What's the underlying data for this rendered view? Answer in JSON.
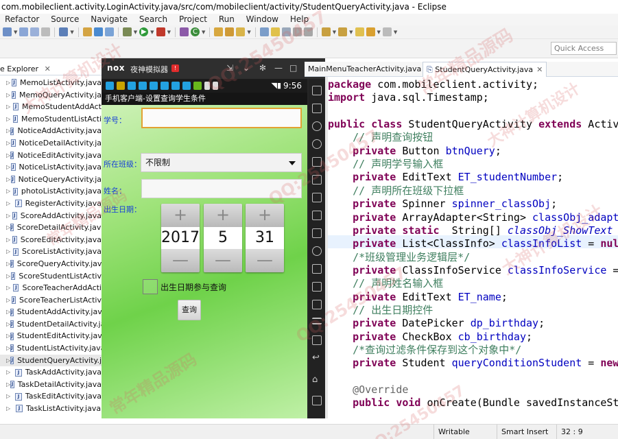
{
  "window": {
    "title": "com.mobileclient.activity.LoginActivity.java/src/com/mobileclient/activity/StudentQueryActivity.java - Eclipse"
  },
  "menu": [
    "Refactor",
    "Source",
    "Navigate",
    "Search",
    "Project",
    "Run",
    "Window",
    "Help"
  ],
  "quick_access": {
    "placeholder": "Quick Access"
  },
  "package_explorer": {
    "title": "e Explorer",
    "close": "✕",
    "files": [
      "MemoListActivity.java",
      "MemoQueryActivity.ja",
      "MemoStudentAddAct",
      "MemoStudentListActi",
      "NoticeAddActivity.java",
      "NoticeDetailActivity.ja",
      "NoticeEditActivity.java",
      "NoticeListActivity.java",
      "NoticeQueryActivity.ja",
      "photoListActivity.java",
      "RegisterActivity.java",
      "ScoreAddActivity.java",
      "ScoreDetailActivity.java",
      "ScoreEditActivity.java",
      "ScoreListActivity.java",
      "ScoreQueryActivity.jav",
      "ScoreStudentListActiv",
      "ScoreTeacherAddActi",
      "ScoreTeacherListActiv",
      "StudentAddActivity.jav",
      "StudentDetailActivity.ja",
      "StudentEditActivity.java",
      "StudentListActivity.java",
      "StudentQueryActivity.j",
      "TaskAddActivity.java",
      "TaskDetailActivity.java",
      "TaskEditActivity.java",
      "TaskListActivity.java"
    ],
    "selected_index": 23
  },
  "emulator": {
    "brand": "nox",
    "name": "夜神模拟器",
    "time": "9:56",
    "app_title": "手机客户端-设置查询学生条件",
    "labels": {
      "student_number": "学号：",
      "class": "所在班级：",
      "name": "姓名：",
      "birthday": "出生日期："
    },
    "spinner_value": "不限制",
    "date": {
      "year": "2017",
      "month": "5",
      "day": "31"
    },
    "plus": "+",
    "minus": "—",
    "checkbox_label": "出生日期参与查询",
    "query_button": "查询"
  },
  "editor": {
    "tabs": [
      "MainMenuTeacherActivity.java",
      "StudentQueryActivity.java"
    ],
    "active_tab": 1,
    "lines": [
      [
        [
          "kw",
          "package"
        ],
        [
          "t",
          " com.mobileclient.activity;"
        ]
      ],
      [
        [
          "kw",
          "import"
        ],
        [
          "t",
          " java.sql.Timestamp;"
        ]
      ],
      [],
      [
        [
          "kw",
          "public"
        ],
        [
          "t",
          " "
        ],
        [
          "kw",
          "class"
        ],
        [
          "t",
          " StudentQueryActivity "
        ],
        [
          "kw",
          "extends"
        ],
        [
          "t",
          " Activi"
        ]
      ],
      [
        [
          "t",
          "    "
        ],
        [
          "cm",
          "// 声明查询按钮"
        ]
      ],
      [
        [
          "t",
          "    "
        ],
        [
          "kw",
          "private"
        ],
        [
          "t",
          " Button "
        ],
        [
          "fd",
          "btnQuery"
        ],
        [
          "t",
          ";"
        ]
      ],
      [
        [
          "t",
          "    "
        ],
        [
          "cm",
          "// 声明学号输入框"
        ]
      ],
      [
        [
          "t",
          "    "
        ],
        [
          "kw",
          "private"
        ],
        [
          "t",
          " EditText "
        ],
        [
          "fd",
          "ET_studentNumber"
        ],
        [
          "t",
          ";"
        ]
      ],
      [
        [
          "t",
          "    "
        ],
        [
          "cm",
          "// 声明所在班级下拉框"
        ]
      ],
      [
        [
          "t",
          "    "
        ],
        [
          "kw",
          "private"
        ],
        [
          "t",
          " Spinner "
        ],
        [
          "fd",
          "spinner_classObj"
        ],
        [
          "t",
          ";"
        ]
      ],
      [
        [
          "t",
          "    "
        ],
        [
          "kw",
          "private"
        ],
        [
          "t",
          " ArrayAdapter<String> "
        ],
        [
          "fd",
          "classObj_adapte"
        ]
      ],
      [
        [
          "t",
          "    "
        ],
        [
          "kw",
          "private"
        ],
        [
          "t",
          " "
        ],
        [
          "kw",
          "static"
        ],
        [
          "t",
          "  String[] "
        ],
        [
          "fi",
          "classObj_ShowText"
        ]
      ],
      [
        [
          "t",
          "    "
        ],
        [
          "kw",
          "private"
        ],
        [
          "t",
          " List<ClassInfo> "
        ],
        [
          "fd",
          "classInfoList"
        ],
        [
          "t",
          " = "
        ],
        [
          "kw",
          "null"
        ]
      ],
      [
        [
          "t",
          "    "
        ],
        [
          "cm",
          "/*班级管理业务逻辑层*/"
        ]
      ],
      [
        [
          "t",
          "    "
        ],
        [
          "kw",
          "private"
        ],
        [
          "t",
          " ClassInfoService "
        ],
        [
          "fd",
          "classInfoService"
        ],
        [
          "t",
          " ="
        ]
      ],
      [
        [
          "t",
          "    "
        ],
        [
          "cm",
          "// 声明姓名输入框"
        ]
      ],
      [
        [
          "t",
          "    "
        ],
        [
          "kw",
          "private"
        ],
        [
          "t",
          " EditText "
        ],
        [
          "fd",
          "ET_name"
        ],
        [
          "t",
          ";"
        ]
      ],
      [
        [
          "t",
          "    "
        ],
        [
          "cm",
          "// 出生日期控件"
        ]
      ],
      [
        [
          "t",
          "    "
        ],
        [
          "kw",
          "private"
        ],
        [
          "t",
          " DatePicker "
        ],
        [
          "fd",
          "dp_birthday"
        ],
        [
          "t",
          ";"
        ]
      ],
      [
        [
          "t",
          "    "
        ],
        [
          "kw",
          "private"
        ],
        [
          "t",
          " CheckBox "
        ],
        [
          "fd",
          "cb_birthday"
        ],
        [
          "t",
          ";"
        ]
      ],
      [
        [
          "t",
          "    "
        ],
        [
          "cm",
          "/*查询过滤条件保存到这个对象中*/"
        ]
      ],
      [
        [
          "t",
          "    "
        ],
        [
          "kw",
          "private"
        ],
        [
          "t",
          " Student "
        ],
        [
          "fd",
          "queryConditionStudent"
        ],
        [
          "t",
          " = "
        ],
        [
          "kw",
          "new"
        ]
      ],
      [],
      [
        [
          "t",
          "    "
        ],
        [
          "an",
          "@Override"
        ]
      ],
      [
        [
          "t",
          "    "
        ],
        [
          "kw",
          "public"
        ],
        [
          "t",
          " "
        ],
        [
          "kw",
          "void"
        ],
        [
          "t",
          " onCreate(Bundle savedInstanceSta"
        ]
      ]
    ]
  },
  "status": {
    "writable": "Writable",
    "insert_mode": "Smart Insert",
    "position": "32 : 9"
  },
  "watermark": {
    "texts": [
      "大神计算机设计",
      "QQ:25450457",
      "常年精品源码",
      "大神计算机设计",
      "QQ:25450457",
      "常年精品源码",
      "大神计算机设计",
      "QQ:25450457",
      "常年精品源码",
      "QQ:25450457"
    ]
  },
  "colors": {
    "keyword": "#7f0055",
    "comment": "#3f7f5f",
    "field": "#0000c0",
    "focus_border": "#e3a132",
    "label_blue": "#1740d8"
  }
}
